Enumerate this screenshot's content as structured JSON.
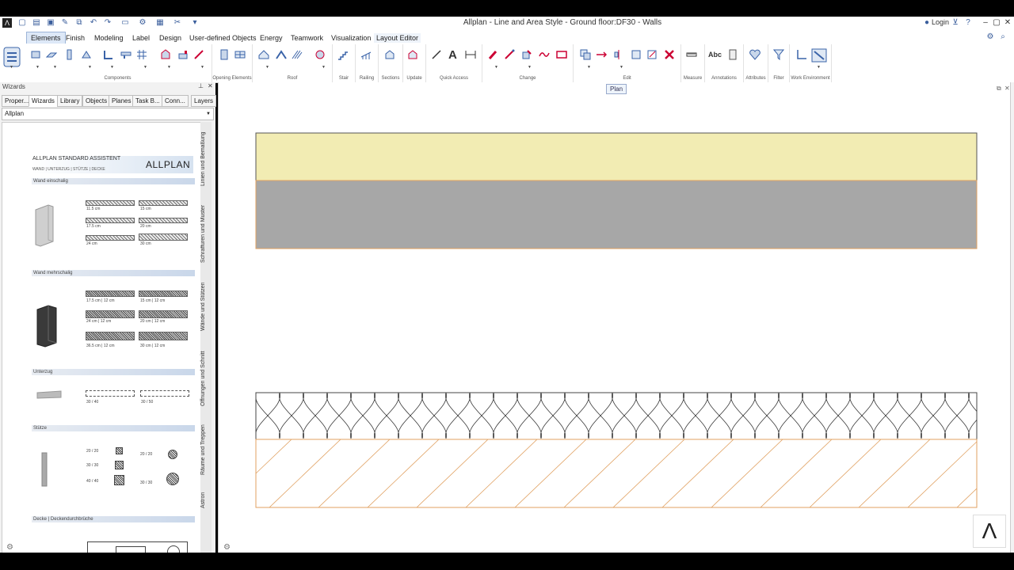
{
  "window": {
    "title": "Allplan - Line and Area Style - Ground floor:DF30 - Walls",
    "login_label": "Login"
  },
  "menu": {
    "tabs": [
      "Elements",
      "Finish",
      "Modeling",
      "Label",
      "Design",
      "User-defined Objects",
      "Energy",
      "Teamwork",
      "Visualization",
      "Layout Editor"
    ],
    "active": "Elements"
  },
  "ribbon": {
    "groups": [
      "Components",
      "Opening Elements",
      "Roof",
      "Stair",
      "Railing",
      "Sections",
      "Update",
      "Quick Access",
      "Change",
      "Edit",
      "Measure",
      "Annotations",
      "Attributes",
      "Filter",
      "Work Environment"
    ]
  },
  "panel": {
    "header": "Wizards",
    "tabs": [
      "Proper...",
      "Wizards",
      "Library",
      "Objects",
      "Planes",
      "Task B...",
      "Conn...",
      "Layers"
    ],
    "active_tab": "Wizards",
    "combo_value": "Allplan",
    "card": {
      "title": "ALLPLAN STANDARD ASSISTENT",
      "subtitle": "WAND | UNTERZUG | STÜTZE | DECKE",
      "logo": "ALLPLAN",
      "sections": {
        "wand_einschalig": "Wand einschalig",
        "wand_mehrschalig": "Wand mehrschalig",
        "unterzug": "Unterzug",
        "stuetze": "Stütze",
        "decke": "Decke | Deckendurchbrüche"
      },
      "einschalig_labels": [
        "11.5 cm",
        "15 cm",
        "17.5 cm",
        "20 cm",
        "24 cm",
        "30 cm"
      ],
      "mehrschalig_labels": [
        "17.5 cm | 12 cm",
        "15 cm | 12 cm",
        "24 cm | 12 cm",
        "20 cm | 12 cm",
        "36.5 cm | 12 cm",
        "30 cm | 12 cm"
      ],
      "unterzug_labels": [
        "30 / 40",
        "30 / 50"
      ],
      "stuetze_labels": [
        "20 / 20",
        "30 / 30",
        "40 / 40",
        "20 / 20",
        "30 / 30"
      ]
    },
    "vertical_tabs": [
      "Linien und Bemaßung",
      "Schraffuren und Muster",
      "Wände und Stützen",
      "Öffnungen und Schnitt",
      "Räume und Treppen",
      "Astron"
    ]
  },
  "canvas": {
    "plan_label": "Plan"
  },
  "colors": {
    "yellow_fill": "#f2ecb3",
    "gray_fill": "#a7a7a7",
    "orange_outline": "#e0a060",
    "ribbon_accent": "#3a63a8"
  }
}
